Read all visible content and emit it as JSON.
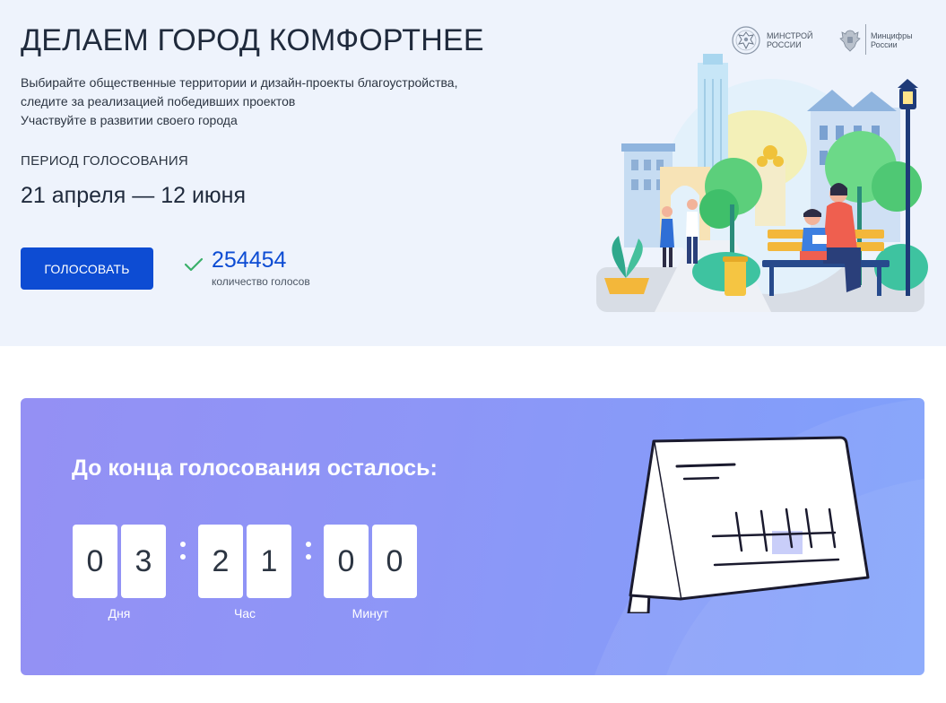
{
  "hero": {
    "title": "ДЕЛАЕМ ГОРОД КОМФОРТНЕЕ",
    "description": [
      "Выбирайте общественные территории и дизайн-проекты благоустройства,",
      "следите за реализацией победивших проектов",
      "Участвуйте в развитии своего города"
    ],
    "period_label": "ПЕРИОД ГОЛОСОВАНИЯ",
    "period_dates": "21 апреля — 12 июня",
    "vote_button": "ГОЛОСОВАТЬ",
    "votes_count": "254454",
    "votes_label": "количество голосов",
    "logos": [
      {
        "name": "minstroy",
        "lines": [
          "МИНСТРОЙ",
          "РОССИИ"
        ]
      },
      {
        "name": "mincifry",
        "lines": [
          "Минцифры",
          "России"
        ]
      }
    ]
  },
  "countdown": {
    "title": "До конца голосования осталось:",
    "days": [
      "0",
      "3"
    ],
    "hours": [
      "2",
      "1"
    ],
    "minutes": [
      "0",
      "0"
    ],
    "labels": {
      "days": "Дня",
      "hours": "Час",
      "minutes": "Минут"
    }
  },
  "colors": {
    "accent": "#0d4cd3",
    "hero_bg": "#eef3fc",
    "card_gradient_start": "#9490f4",
    "card_gradient_end": "#7fa1fb",
    "check": "#3ab06a"
  }
}
